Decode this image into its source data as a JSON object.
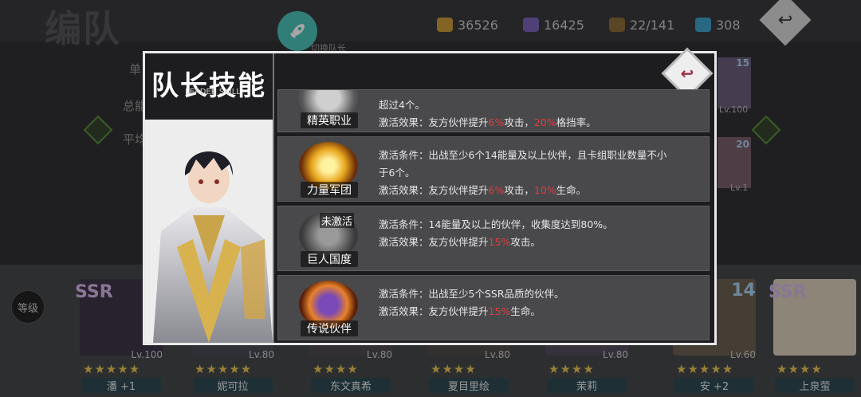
{
  "header": {
    "title": "编队",
    "resources": [
      {
        "icon": "gold-coin-icon",
        "value": "36526",
        "color": "#c99a3a"
      },
      {
        "icon": "crystal-icon",
        "value": "16425",
        "color": "#7b63b8"
      },
      {
        "icon": "chest-icon",
        "value": "22/141",
        "color": "#8a6a3a"
      },
      {
        "icon": "gem-icon",
        "value": "308",
        "color": "#3fa0c8"
      }
    ],
    "back_icon": "↩"
  },
  "background": {
    "switch_leader": "切换队长",
    "stat1": "单",
    "stat2": "总能",
    "stat3": "平均",
    "level_button": "等级"
  },
  "cards": [
    {
      "name": "潘 +1",
      "lv": "Lv.100",
      "stars": "★★★★★",
      "tag": "SSR"
    },
    {
      "name": "妮可拉",
      "lv": "Lv.80",
      "stars": "★★★★★",
      "tag": ""
    },
    {
      "name": "东文真希",
      "lv": "Lv.80",
      "stars": "★★★★",
      "tag": ""
    },
    {
      "name": "夏目里绘",
      "lv": "Lv.80",
      "stars": "★★★★",
      "tag": ""
    },
    {
      "name": "茉莉",
      "lv": "Lv.80",
      "stars": "★★★★",
      "tag": ""
    },
    {
      "name": "安 +2",
      "lv": "Lv.60",
      "stars": "★★★★★",
      "tag": "14"
    },
    {
      "name": "上泉萤",
      "lv": "",
      "stars": "★★★★",
      "tag": "SSR"
    }
  ],
  "side_cards": [
    {
      "lv": "Lv.100",
      "tag": "15"
    },
    {
      "lv": "Lv.1",
      "tag": "20"
    }
  ],
  "modal": {
    "title": "队长技能",
    "subtitle": "LEADER SKILL",
    "back_icon": "↩",
    "skills": [
      {
        "name": "精英职业",
        "badge": "",
        "lines": [
          {
            "pre": "超过4个。",
            "v1": "",
            "mid": "",
            "v2": "",
            "post": ""
          },
          {
            "pre": "激活效果：友方伙伴提升",
            "v1": "6%",
            "mid": "攻击，",
            "v2": "20%",
            "post": "格挡率。"
          }
        ]
      },
      {
        "name": "力量军团",
        "badge": "",
        "lines": [
          {
            "pre": "激活条件：出战至少6个14能量及以上伙伴，且卡组职业数量不小",
            "v1": "",
            "mid": "",
            "v2": "",
            "post": ""
          },
          {
            "pre": "于6个。",
            "v1": "",
            "mid": "",
            "v2": "",
            "post": ""
          },
          {
            "pre": "激活效果：友方伙伴提升",
            "v1": "6%",
            "mid": "攻击，",
            "v2": "10%",
            "post": "生命。"
          }
        ]
      },
      {
        "name": "巨人国度",
        "badge": "未激活",
        "lines": [
          {
            "pre": "激活条件：14能量及以上的伙伴，收集度达到80%。",
            "v1": "",
            "mid": "",
            "v2": "",
            "post": ""
          },
          {
            "pre": "激活效果：友方伙伴提升",
            "v1": "15%",
            "mid": "攻击。",
            "v2": "",
            "post": ""
          }
        ]
      },
      {
        "name": "传说伙伴",
        "badge": "",
        "lines": [
          {
            "pre": "激活条件：出战至少5个SSR品质的伙伴。",
            "v1": "",
            "mid": "",
            "v2": "",
            "post": ""
          },
          {
            "pre": "激活效果：友方伙伴提升",
            "v1": "15%",
            "mid": "生命。",
            "v2": "",
            "post": ""
          }
        ]
      }
    ]
  }
}
